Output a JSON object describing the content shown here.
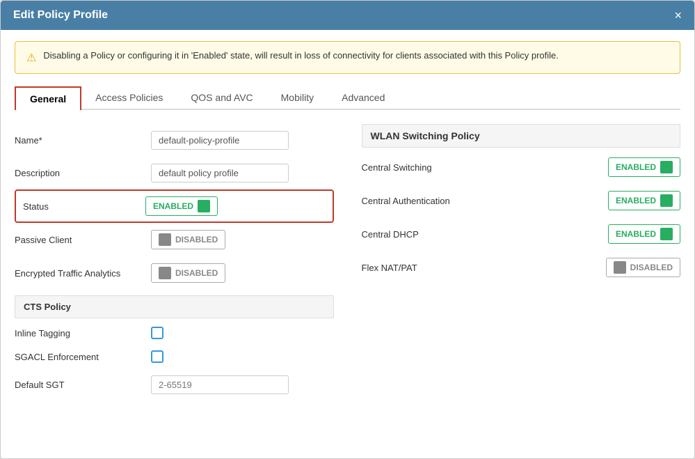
{
  "modal": {
    "title": "Edit Policy Profile",
    "close_label": "×"
  },
  "warning": {
    "icon": "⚠",
    "text": "Disabling a Policy or configuring it in 'Enabled' state, will result in loss of connectivity for clients associated with this Policy profile."
  },
  "tabs": [
    {
      "id": "general",
      "label": "General",
      "active": true
    },
    {
      "id": "access-policies",
      "label": "Access Policies",
      "active": false
    },
    {
      "id": "qos-avc",
      "label": "QOS and AVC",
      "active": false
    },
    {
      "id": "mobility",
      "label": "Mobility",
      "active": false
    },
    {
      "id": "advanced",
      "label": "Advanced",
      "active": false
    }
  ],
  "form": {
    "name_label": "Name*",
    "name_value": "default-policy-profile",
    "description_label": "Description",
    "description_value": "default policy profile",
    "status_label": "Status",
    "status_value": "ENABLED",
    "passive_client_label": "Passive Client",
    "passive_client_value": "DISABLED",
    "encrypted_label": "Encrypted Traffic Analytics",
    "encrypted_value": "DISABLED",
    "cts_section": "CTS Policy",
    "inline_tagging_label": "Inline Tagging",
    "sgacl_label": "SGACL Enforcement",
    "default_sgt_label": "Default SGT",
    "default_sgt_placeholder": "2-65519"
  },
  "wlan": {
    "section_title": "WLAN Switching Policy",
    "central_switching_label": "Central Switching",
    "central_switching_value": "ENABLED",
    "central_auth_label": "Central Authentication",
    "central_auth_value": "ENABLED",
    "central_dhcp_label": "Central DHCP",
    "central_dhcp_value": "ENABLED",
    "flex_nat_label": "Flex NAT/PAT",
    "flex_nat_value": "DISABLED"
  }
}
